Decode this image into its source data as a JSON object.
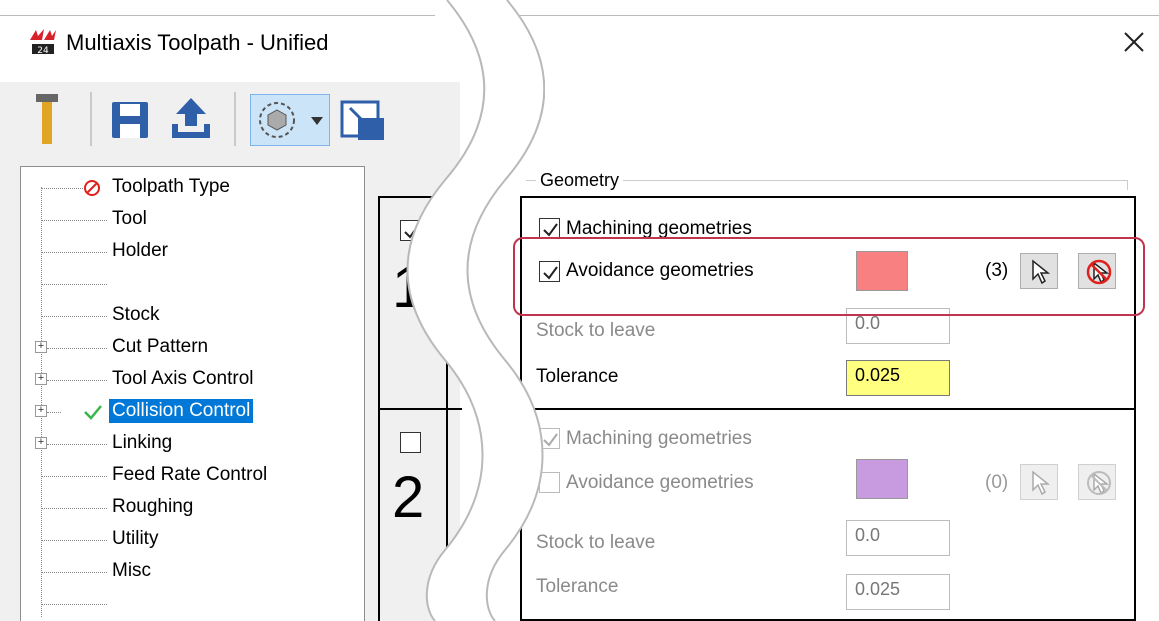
{
  "window": {
    "title": "Multiaxis Toolpath - Unified",
    "logo_icon": "mastercam-logo-icon",
    "close_icon": "close-icon"
  },
  "toolbar": {
    "items": [
      "tool-icon",
      "save-icon",
      "upload-icon",
      "view-sphere-icon",
      "dropdown-arrow-icon",
      "dock-window-icon"
    ]
  },
  "tree": {
    "items": [
      {
        "label": "Toolpath Type",
        "status": "error"
      },
      {
        "label": "Tool"
      },
      {
        "label": "Holder"
      },
      {
        "label": ""
      },
      {
        "label": "Stock"
      },
      {
        "label": "Cut Pattern",
        "expandable": true
      },
      {
        "label": "Tool Axis Control",
        "expandable": true
      },
      {
        "label": "Collision Control",
        "expandable": true,
        "status": "ok",
        "selected": true
      },
      {
        "label": "Linking",
        "expandable": true
      },
      {
        "label": "Feed Rate Control"
      },
      {
        "label": "Roughing"
      },
      {
        "label": "Utility"
      },
      {
        "label": "Misc"
      },
      {
        "label": ""
      }
    ]
  },
  "rows": {
    "row1_number": "1",
    "row2_number": "2"
  },
  "geometry": {
    "group_label": "Geometry",
    "row1": {
      "machining_label": "Machining geometries",
      "avoidance_label": "Avoidance geometries",
      "avoidance_color": "#f98080",
      "count": "(3)",
      "stock_label": "Stock to leave",
      "stock_value": "0.0",
      "tolerance_label": "Tolerance",
      "tolerance_value": "0.025"
    },
    "row2": {
      "machining_label": "Machining geometries",
      "avoidance_label": "Avoidance geometries",
      "avoidance_color": "#c89be0",
      "count": "(0)",
      "stock_label": "Stock to leave",
      "stock_value": "0.0",
      "tolerance_label": "Tolerance",
      "tolerance_value": "0.025"
    }
  },
  "colors": {
    "highlight": "#c0344d",
    "selection": "#0078d7",
    "tolerance_field": "#ffff80"
  }
}
